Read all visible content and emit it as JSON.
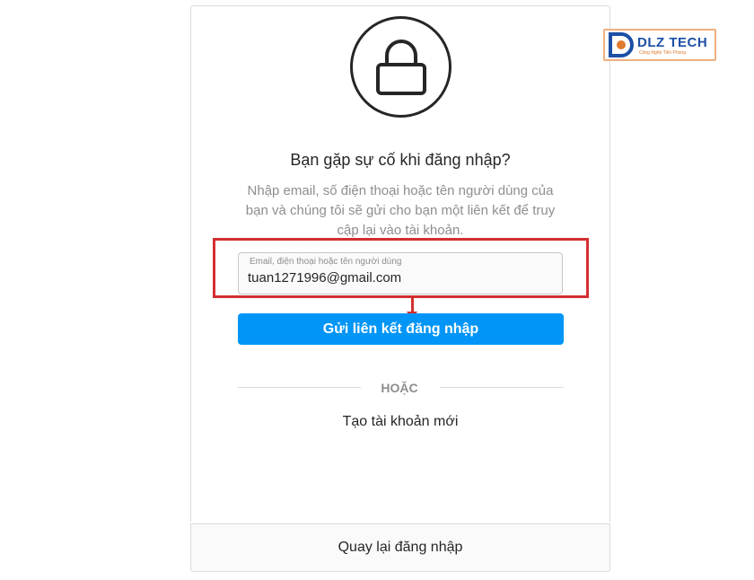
{
  "dialog": {
    "title": "Bạn gặp sự cố khi đăng nhập?",
    "description": "Nhập email, số điện thoại hoặc tên người dùng của bạn và chúng tôi sẽ gửi cho bạn một liên kết để truy cập lại vào tài khoản.",
    "input": {
      "placeholder": "Email, điện thoại hoặc tên người dùng",
      "value": "tuan1271996@gmail.com"
    },
    "send_button": "Gửi liên kết đăng nhập",
    "divider_text": "HOẶC",
    "create_account": "Tạo tài khoản mới",
    "back_to_login": "Quay lại đăng nhập"
  },
  "logo": {
    "name": "DLZ TECH",
    "tagline": "Công Nghệ Tiên Phong",
    "letter": "D"
  },
  "colors": {
    "primary": "#0095f6",
    "highlight": "#d32f2f",
    "logo_blue": "#1d4fa6",
    "logo_orange": "#e07b2e"
  }
}
